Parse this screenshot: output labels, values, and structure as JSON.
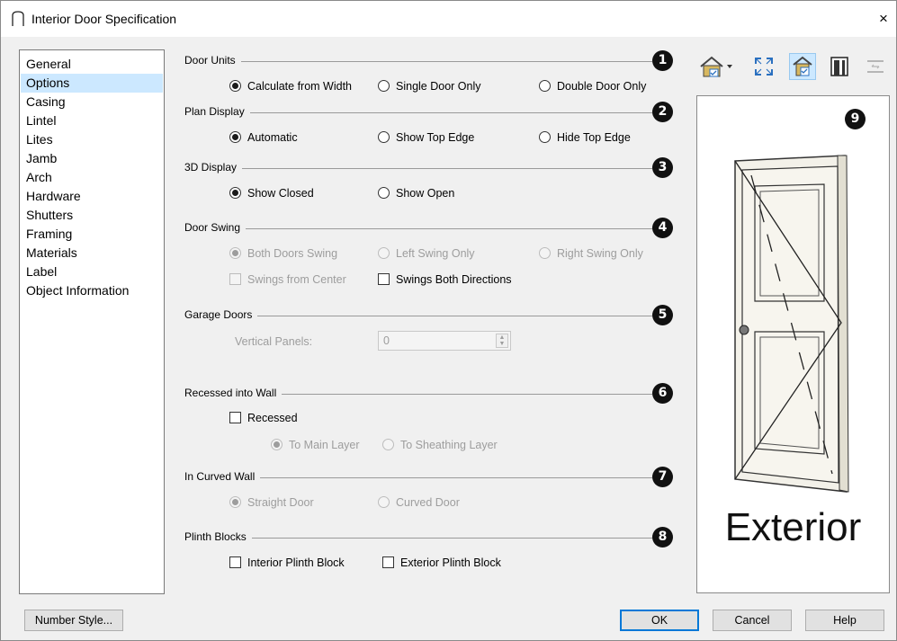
{
  "window": {
    "title": "Interior Door Specification",
    "close_glyph": "×"
  },
  "categories": [
    {
      "label": "General",
      "selected": false
    },
    {
      "label": "Options",
      "selected": true
    },
    {
      "label": "Casing",
      "selected": false
    },
    {
      "label": "Lintel",
      "selected": false
    },
    {
      "label": "Lites",
      "selected": false
    },
    {
      "label": "Jamb",
      "selected": false
    },
    {
      "label": "Arch",
      "selected": false
    },
    {
      "label": "Hardware",
      "selected": false
    },
    {
      "label": "Shutters",
      "selected": false
    },
    {
      "label": "Framing",
      "selected": false
    },
    {
      "label": "Materials",
      "selected": false
    },
    {
      "label": "Label",
      "selected": false
    },
    {
      "label": "Object Information",
      "selected": false
    }
  ],
  "sections": {
    "door_units": {
      "title": "Door Units",
      "badge": "1",
      "options": [
        "Calculate from Width",
        "Single Door Only",
        "Double Door Only"
      ],
      "selected": 0
    },
    "plan_display": {
      "title": "Plan Display",
      "badge": "2",
      "options": [
        "Automatic",
        "Show Top Edge",
        "Hide Top Edge"
      ],
      "selected": 0
    },
    "display_3d": {
      "title": "3D Display",
      "badge": "3",
      "options": [
        "Show Closed",
        "Show Open"
      ],
      "selected": 0
    },
    "door_swing": {
      "title": "Door Swing",
      "badge": "4",
      "options": [
        "Both Doors Swing",
        "Left Swing Only",
        "Right Swing Only"
      ],
      "selected": 0,
      "disabled": true,
      "swings_from_center": "Swings from Center",
      "swings_both_directions": "Swings Both Directions"
    },
    "garage_doors": {
      "title": "Garage Doors",
      "badge": "5",
      "vertical_panels_label": "Vertical Panels:",
      "vertical_panels_value": "0"
    },
    "recessed": {
      "title": "Recessed into Wall",
      "badge": "6",
      "checkbox": "Recessed",
      "options": [
        "To Main Layer",
        "To Sheathing Layer"
      ],
      "selected": 0
    },
    "curved_wall": {
      "title": "In Curved Wall",
      "badge": "7",
      "options": [
        "Straight Door",
        "Curved Door"
      ],
      "selected": 0
    },
    "plinth": {
      "title": "Plinth Blocks",
      "badge": "8",
      "interior": "Interior Plinth Block",
      "exterior": "Exterior Plinth Block"
    }
  },
  "preview": {
    "badge": "9",
    "side_label": "Exterior"
  },
  "toolbar": {
    "icons": [
      "view-mode-icon",
      "fill-window-icon",
      "show-lines-icon",
      "show-casing-icon",
      "reverse-view-icon"
    ]
  },
  "buttons": {
    "number_style": "Number Style...",
    "ok": "OK",
    "cancel": "Cancel",
    "help": "Help"
  },
  "colors": {
    "selection": "#cce8ff",
    "default_button_border": "#0078d7",
    "badge": "#111111",
    "disabled_text": "#9d9d9d"
  }
}
